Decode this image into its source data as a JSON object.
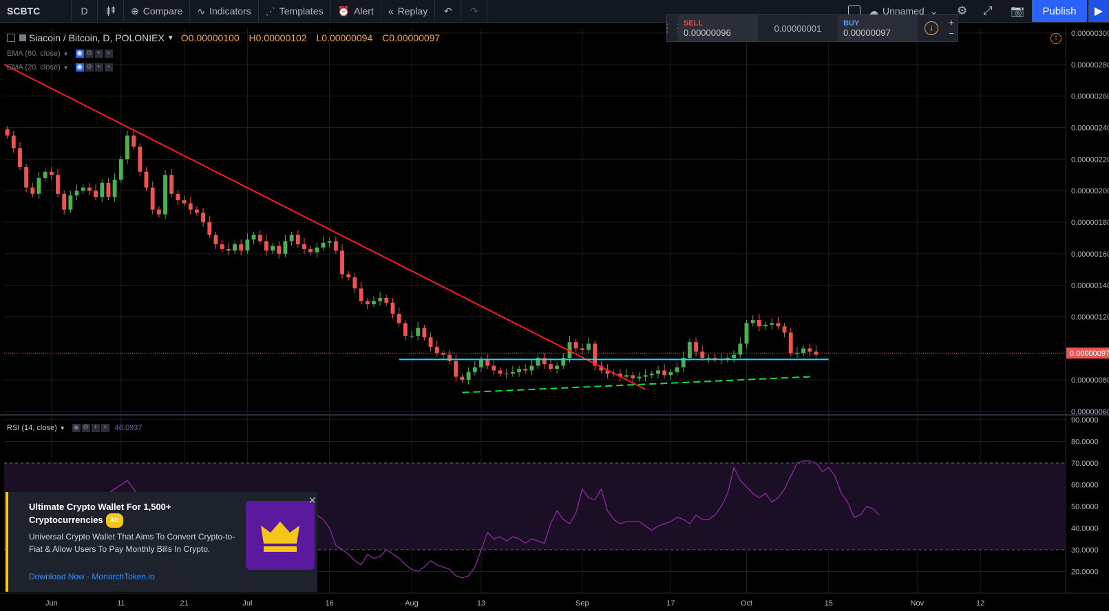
{
  "toolbar": {
    "symbol": "SCBTC",
    "interval": "D",
    "compare": "Compare",
    "indicators": "Indicators",
    "templates": "Templates",
    "alert": "Alert",
    "replay": "Replay",
    "layout_name": "Unnamed",
    "publish": "Publish"
  },
  "legend": {
    "title": "Siacoin / Bitcoin, D, POLONIEX",
    "open": "O0.00000100",
    "high": "H0.00000102",
    "low": "L0.00000094",
    "close": "C0.00000097",
    "ema60": "EMA (60, close)",
    "ema20": "EMA (20, close)",
    "rsi": "RSI (14, close)",
    "rsi_value": "46.0937"
  },
  "trade": {
    "sell_label": "SELL",
    "sell_price": "0.00000096",
    "spread": "0.00000001",
    "buy_label": "BUY",
    "buy_price": "0.00000097"
  },
  "ad": {
    "title": "Ultimate Crypto Wallet For 1,500+ Cryptocurrencies",
    "badge": "AD",
    "description": "Universal Crypto Wallet That Aims To Convert Crypto-to-Fiat & Allow Users To Pay Monthly Bills In Crypto.",
    "link": "Download Now - MonarchToken.io"
  },
  "colors": {
    "up": "#4caf50",
    "down": "#ef5350",
    "rsi": "#9c27b0",
    "trend": "#ff1a1a",
    "support": "#00e5ff",
    "rising": "#00e640"
  },
  "chart_data": [
    {
      "type": "candlestick",
      "title": "Siacoin / Bitcoin, D, POLONIEX",
      "ylim": [
        6e-07,
        3e-06
      ],
      "y_ticks": [
        "0.00000300",
        "0.00000280",
        "0.00000260",
        "0.00000240",
        "0.00000220",
        "0.00000200",
        "0.00000180",
        "0.00000160",
        "0.00000140",
        "0.00000120",
        "0.00000080",
        "0.00000060"
      ],
      "y_tick_values": [
        3.0,
        2.8,
        2.6,
        2.4,
        2.2,
        2.0,
        1.8,
        1.6,
        1.4,
        1.2,
        0.8,
        0.6
      ],
      "x_labels": [
        "Jun",
        "11",
        "21",
        "Jul",
        "16",
        "Aug",
        "13",
        "Sep",
        "17",
        "Oct",
        "15",
        "Nov",
        "12"
      ],
      "x_label_index": [
        7,
        18,
        28,
        38,
        51,
        64,
        75,
        91,
        105,
        117,
        130,
        144,
        154
      ],
      "x_count": 168,
      "last_price_label": "0.00000097",
      "last_price": 0.97,
      "candles_close_e6": [
        2.35,
        2.27,
        2.15,
        2.02,
        1.98,
        2.08,
        2.12,
        2.1,
        1.98,
        1.88,
        1.97,
        2.0,
        2.02,
        2.0,
        1.96,
        2.05,
        1.96,
        2.07,
        2.2,
        2.35,
        2.28,
        2.12,
        2.02,
        1.88,
        1.85,
        2.1,
        1.98,
        1.94,
        1.92,
        1.88,
        1.86,
        1.8,
        1.72,
        1.66,
        1.63,
        1.62,
        1.66,
        1.62,
        1.69,
        1.72,
        1.68,
        1.62,
        1.65,
        1.6,
        1.68,
        1.72,
        1.66,
        1.63,
        1.61,
        1.64,
        1.67,
        1.68,
        1.62,
        1.47,
        1.45,
        1.38,
        1.3,
        1.28,
        1.3,
        1.32,
        1.29,
        1.22,
        1.16,
        1.08,
        1.08,
        1.13,
        1.07,
        1.01,
        0.97,
        0.96,
        0.92,
        0.82,
        0.8,
        0.85,
        0.88,
        0.93,
        0.89,
        0.86,
        0.84,
        0.84,
        0.85,
        0.87,
        0.86,
        0.89,
        0.94,
        0.9,
        0.87,
        0.89,
        0.94,
        1.04,
        1.0,
        0.99,
        1.03,
        0.89,
        0.86,
        0.84,
        0.84,
        0.82,
        0.83,
        0.81,
        0.82,
        0.83,
        0.84,
        0.86,
        0.83,
        0.85,
        0.88,
        0.94,
        1.04,
        0.98,
        0.94,
        0.94,
        0.93,
        0.93,
        0.94,
        0.96,
        1.03,
        1.16,
        1.18,
        1.14,
        1.15,
        1.16,
        1.14,
        1.1,
        0.97,
        0.97,
        1.0,
        0.98,
        0.96
      ],
      "trend_line": {
        "from": [
          0,
          2.8
        ],
        "to": [
          101,
          0.74
        ]
      },
      "support_line": 0.93,
      "support_range": [
        62,
        130
      ],
      "rising_line": {
        "from": [
          72,
          0.72
        ],
        "to": [
          127,
          0.82
        ]
      }
    },
    {
      "type": "line",
      "title": "RSI (14, close)",
      "ylim": [
        10,
        90
      ],
      "y_ticks": [
        "90.0000",
        "80.0000",
        "70.0000",
        "60.0000",
        "50.0000",
        "40.0000",
        "30.0000",
        "20.0000"
      ],
      "y_tick_values": [
        90,
        80,
        70,
        60,
        50,
        40,
        30,
        20
      ],
      "band": [
        30,
        70
      ],
      "rsi_x_start": 0,
      "rsi_values": [
        48,
        46,
        44,
        42,
        44,
        46,
        48,
        50,
        52,
        54,
        56,
        54,
        52,
        50,
        52,
        54,
        56,
        58,
        60,
        62,
        58,
        54,
        52,
        50,
        48,
        46,
        44,
        46,
        48,
        50,
        52,
        50,
        48,
        46,
        44,
        42,
        44,
        46,
        48,
        50,
        48,
        46,
        44,
        42,
        40,
        44,
        48,
        47,
        45,
        46,
        44,
        40,
        32,
        30,
        28,
        25,
        23,
        28,
        26,
        27,
        30,
        28,
        26,
        23,
        21,
        20,
        22,
        25,
        23,
        22,
        21,
        18,
        17,
        18,
        22,
        30,
        38,
        35,
        36,
        34,
        36,
        35,
        33,
        35,
        34,
        33,
        42,
        48,
        44,
        42,
        47,
        58,
        54,
        53,
        58,
        48,
        44,
        42,
        43,
        43,
        43,
        41,
        39,
        41,
        42,
        43,
        45,
        44,
        42,
        46,
        44,
        44,
        46,
        50,
        56,
        68,
        62,
        59,
        56,
        54,
        56,
        52,
        54,
        58,
        64,
        70,
        71,
        71,
        70,
        66,
        68,
        64,
        56,
        52,
        45,
        46,
        50,
        49,
        46
      ]
    }
  ]
}
